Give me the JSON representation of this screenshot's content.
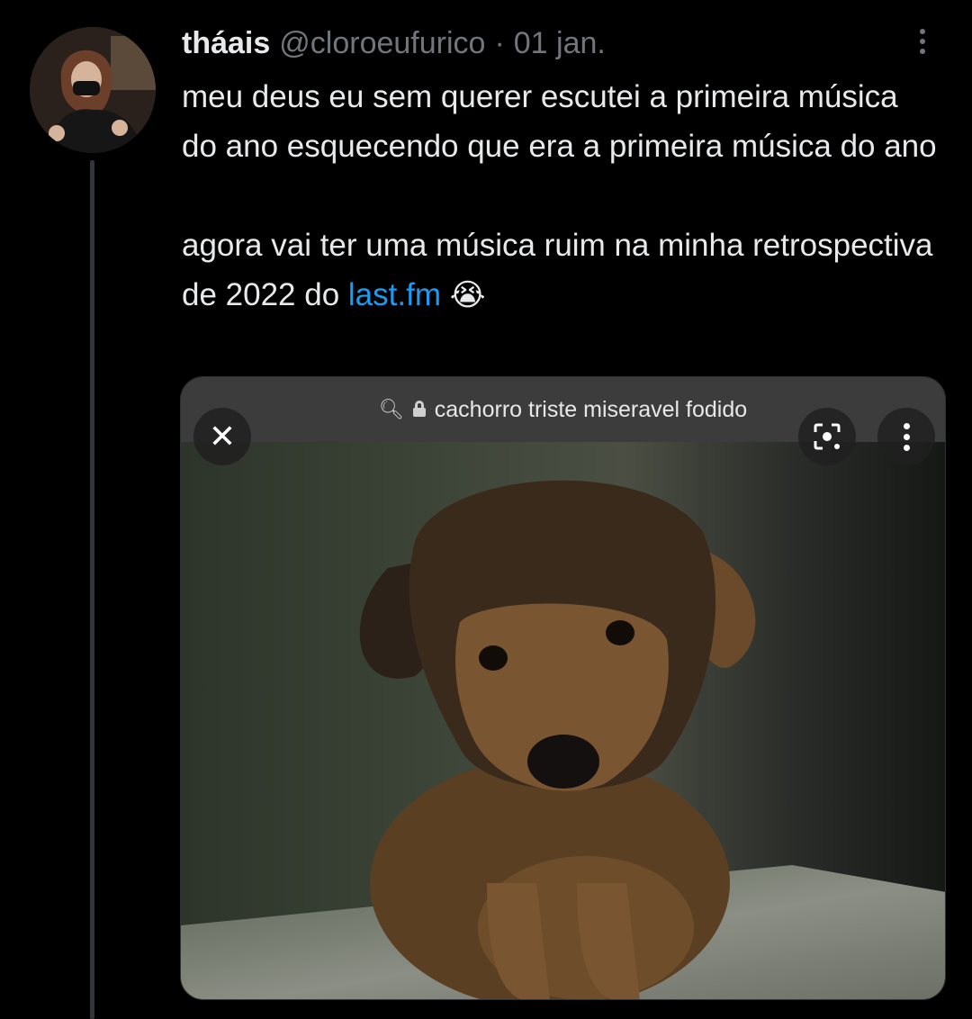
{
  "tweet": {
    "display_name": "tháais",
    "handle": "@cloroeufurico",
    "separator": "·",
    "date": "01 jan.",
    "text_line1": "meu deus eu sem querer escutei a primeira música do ano esquecendo que era a primeira música do ano",
    "text_line2_prefix": "agora vai ter uma música ruim na minha retrospectiva de 2022 do ",
    "link_text": "last.fm",
    "emoji": "😭"
  },
  "media": {
    "url_bar_text": "cachorro triste miseravel fodido",
    "close_glyph": "✕",
    "icons": [
      "search-icon",
      "lock-icon",
      "close-icon",
      "lens-icon",
      "more-vertical-icon"
    ]
  },
  "colors": {
    "background": "#000000",
    "text": "#e7e9ea",
    "muted": "#71767b",
    "link": "#1d9bf0"
  }
}
